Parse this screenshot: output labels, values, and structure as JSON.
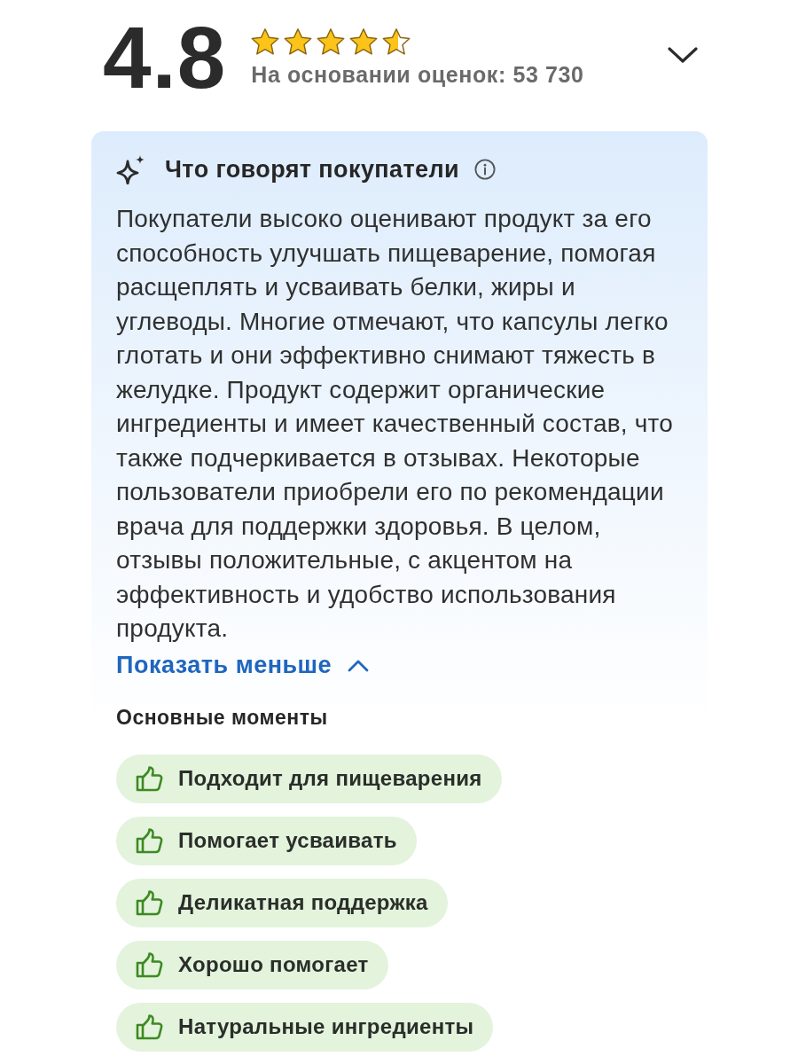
{
  "rating": {
    "score": "4.8",
    "stars": 4.6,
    "count_label": "На основании оценок: 53 730"
  },
  "summary": {
    "title": "Что говорят покупатели",
    "text": "Покупатели высоко оценивают продукт за его способность улучшать пищеварение, помогая расщеплять и усваивать белки, жиры и углеводы. Многие отмечают, что капсулы легко глотать и они эффективно снимают тяжесть в желудке. Продукт содержит органические ингредиенты и имеет качественный состав, что также подчеркивается в отзывах. Некоторые пользователи приобрели его по рекомендации врача для поддержки здоровья. В целом, отзывы положительные, с акцентом на эффективность и удобство использования продукта.",
    "toggle_label": "Показать меньше",
    "expanded": true
  },
  "highlights": {
    "title": "Основные моменты",
    "items": [
      {
        "label": "Подходит для пищеварения"
      },
      {
        "label": "Помогает усваивать"
      },
      {
        "label": "Деликатная поддержка"
      },
      {
        "label": "Хорошо помогает"
      },
      {
        "label": "Натуральные ингредиенты"
      }
    ]
  }
}
